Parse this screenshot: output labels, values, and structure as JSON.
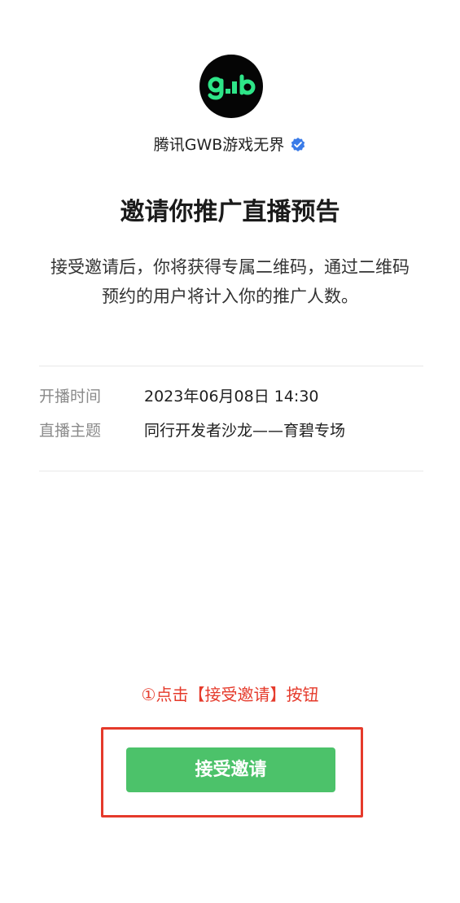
{
  "account": {
    "logo_text": "gʲb",
    "name": "腾讯GWB游戏无界",
    "verified_icon": "verified-badge-icon",
    "logo_bg_color": "#050505",
    "logo_fg_color": "#2ee588",
    "verified_color": "#3a7be8"
  },
  "invite": {
    "title": "邀请你推广直播预告",
    "description_line1": "接受邀请后，你将获得专属二维码，通过二维码",
    "description_line2": "预约的用户将计入你的推广人数。"
  },
  "details": [
    {
      "label": "开播时间",
      "value": "2023年06月08日 14:30"
    },
    {
      "label": "直播主题",
      "value": "同行开发者沙龙——育碧专场"
    }
  ],
  "annotation": {
    "text": "①点击【接受邀请】按钮",
    "color": "#e53a2b"
  },
  "accept_button": {
    "label": "接受邀请",
    "color": "#4cc26a"
  }
}
